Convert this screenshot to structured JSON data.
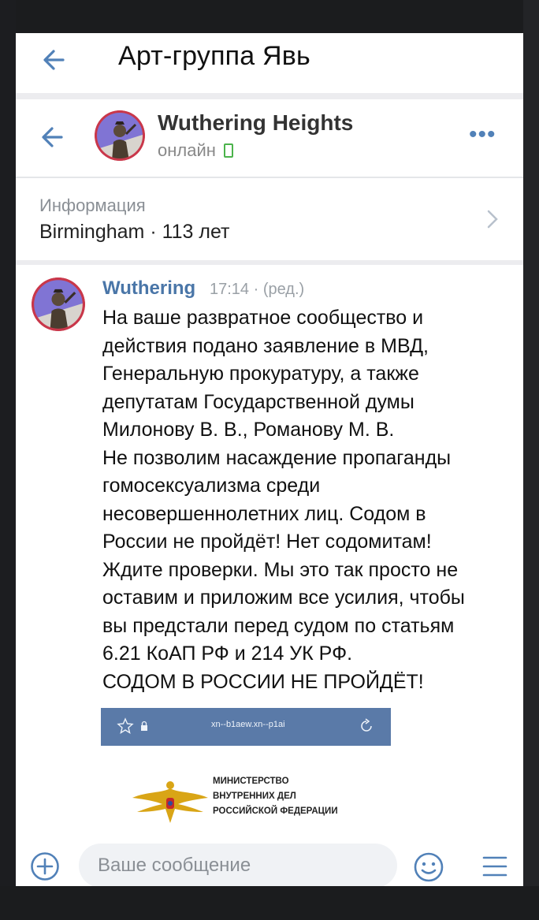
{
  "header": {
    "title": "Арт-группа Явь"
  },
  "chat": {
    "name": "Wuthering Heights",
    "status": "онлайн",
    "more_icon": "more-dots-icon"
  },
  "info": {
    "label": "Информация",
    "value": "Birmingham · 113 лет"
  },
  "message": {
    "author": "Wuthering",
    "time": "17:14 · (ред.)",
    "lines": [
      "На ваше развратное сообщество и",
      "действия подано заявление в МВД,",
      "Генеральную прокуратуру, а также",
      "депутатам Государственной думы",
      "Милонову В. В., Романову М. В.",
      "Не позволим насаждение пропаганды",
      "гомосексуализма среди",
      "несовершеннолетних лиц. Содом в",
      "России не пройдёт! Нет содомитам!",
      "Ждите проверки. Мы это так просто не",
      "оставим и приложим все усилия, чтобы",
      "вы предстали перед судом по статьям",
      "6.21 КоАП РФ и 214 УК РФ.",
      "СОДОМ В РОССИИ НЕ ПРОЙДЁТ!"
    ]
  },
  "attachment": {
    "url": "xn--b1aew.xn--p1ai",
    "ministry_lines": [
      "МИНИСТЕРСТВО",
      "ВНУТРЕННИХ ДЕЛ",
      "РОССИЙСКОЙ ФЕДЕРАЦИИ"
    ]
  },
  "composer": {
    "placeholder": "Ваше сообщение"
  },
  "colors": {
    "accent": "#5181b8",
    "link": "#4a76a8",
    "online": "#4bb34b"
  }
}
